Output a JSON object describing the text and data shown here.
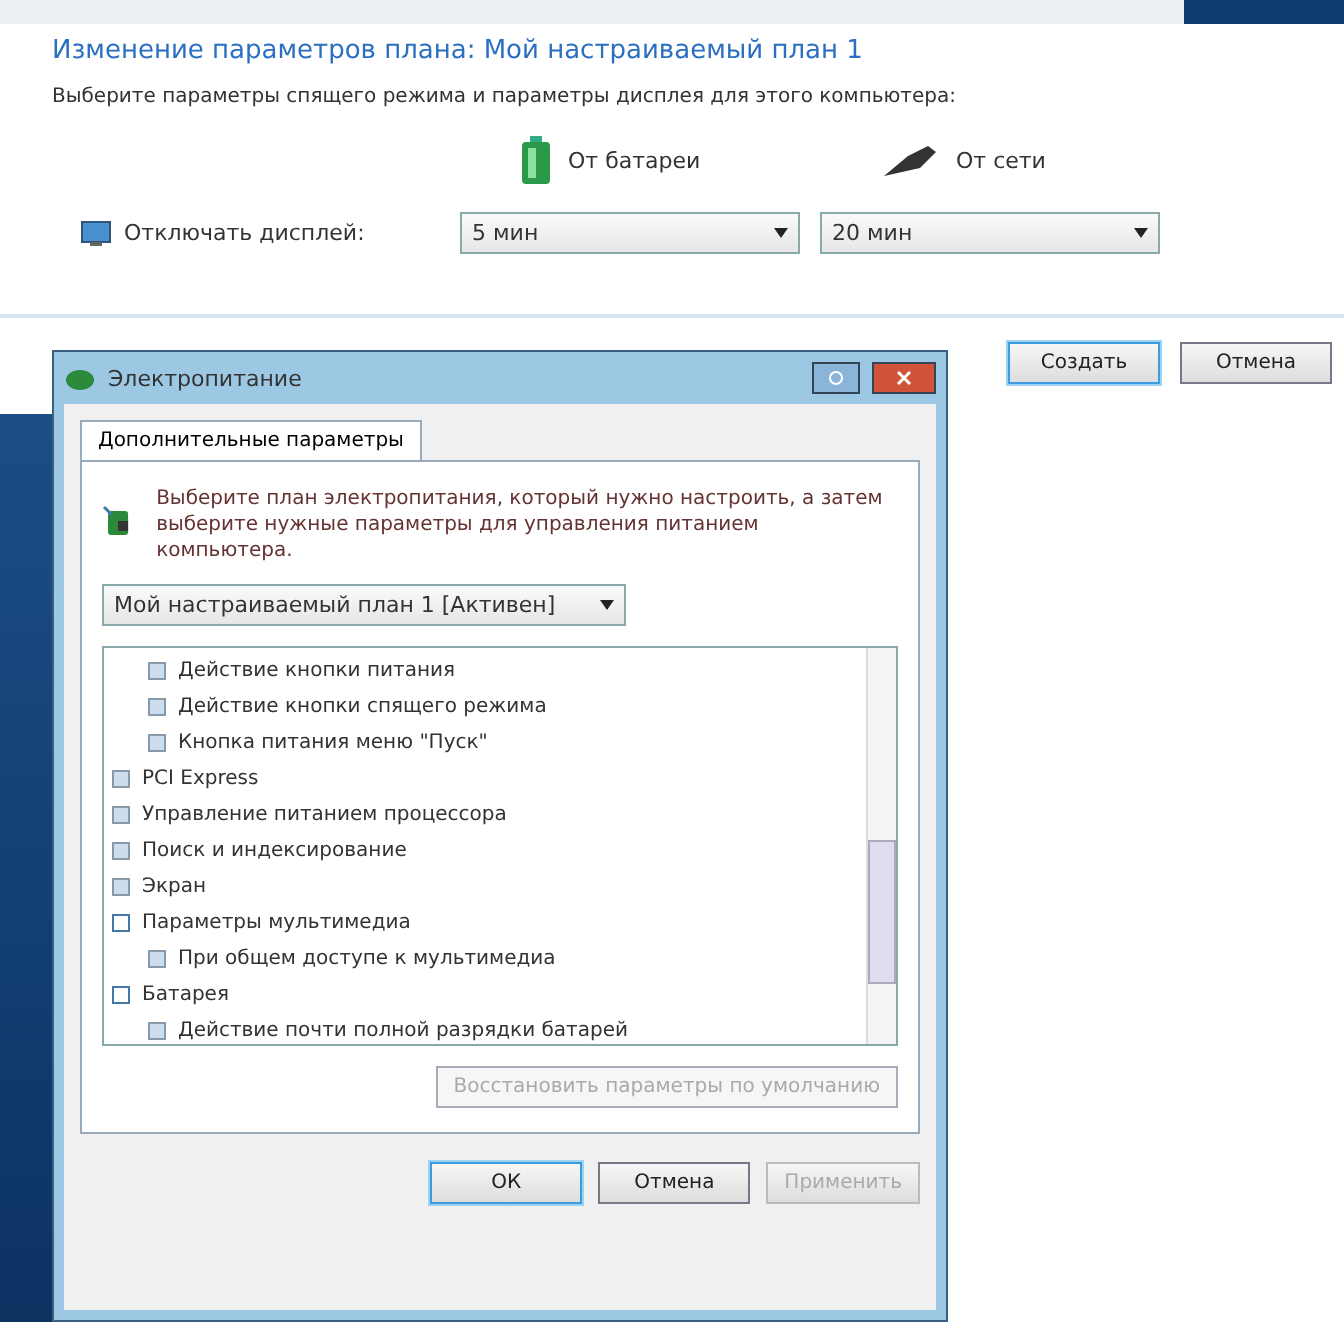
{
  "plan_editor": {
    "title": "Изменение параметров плана: Мой настраиваемый план 1",
    "subtitle": "Выберите параметры спящего режима и параметры дисплея для этого компьютера:",
    "columns": [
      "От батареи",
      "От сети"
    ],
    "settings": [
      {
        "label": "Отключать дисплей:",
        "values": [
          "5 мин",
          "20 мин"
        ]
      }
    ],
    "buttons": [
      {
        "label": "Создать",
        "default": true
      },
      {
        "label": "Отмена",
        "default": false
      }
    ]
  },
  "dialog": {
    "title": "Электропитание",
    "tabs": [
      {
        "label": "Дополнительные параметры",
        "selected": true
      }
    ],
    "intro": "Выберите план электропитания, который нужно настроить, а затем выберите нужные параметры для управления питанием компьютера.",
    "plan_select": "Мой настраиваемый план 1 [Активен]",
    "tree": {
      "leading_children": [
        {
          "label": "Действие кнопки питания",
          "expanded": false
        },
        {
          "label": "Действие кнопки спящего режима",
          "expanded": false
        },
        {
          "label": "Кнопка питания меню \"Пуск\"",
          "expanded": false
        }
      ],
      "items": [
        {
          "label": "PCI Express",
          "expanded": false
        },
        {
          "label": "Управление питанием процессора",
          "expanded": false
        },
        {
          "label": "Поиск и индексирование",
          "expanded": false
        },
        {
          "label": "Экран",
          "expanded": false
        },
        {
          "label": "Параметры мультимедиа",
          "expanded": true,
          "children": [
            {
              "label": "При общем доступе к мультимедиа",
              "expanded": false
            }
          ]
        },
        {
          "label": "Батарея",
          "expanded": true,
          "children": [
            {
              "label": "Действие почти полной разрядки батарей",
              "expanded": false
            }
          ]
        }
      ]
    },
    "restore_button": {
      "label": "Восстановить параметры по умолчанию",
      "disabled": true
    },
    "buttons": [
      {
        "label": "ОК",
        "default": true,
        "disabled": false
      },
      {
        "label": "Отмена",
        "default": false,
        "disabled": false
      },
      {
        "label": "Применить",
        "default": false,
        "disabled": true
      }
    ]
  }
}
